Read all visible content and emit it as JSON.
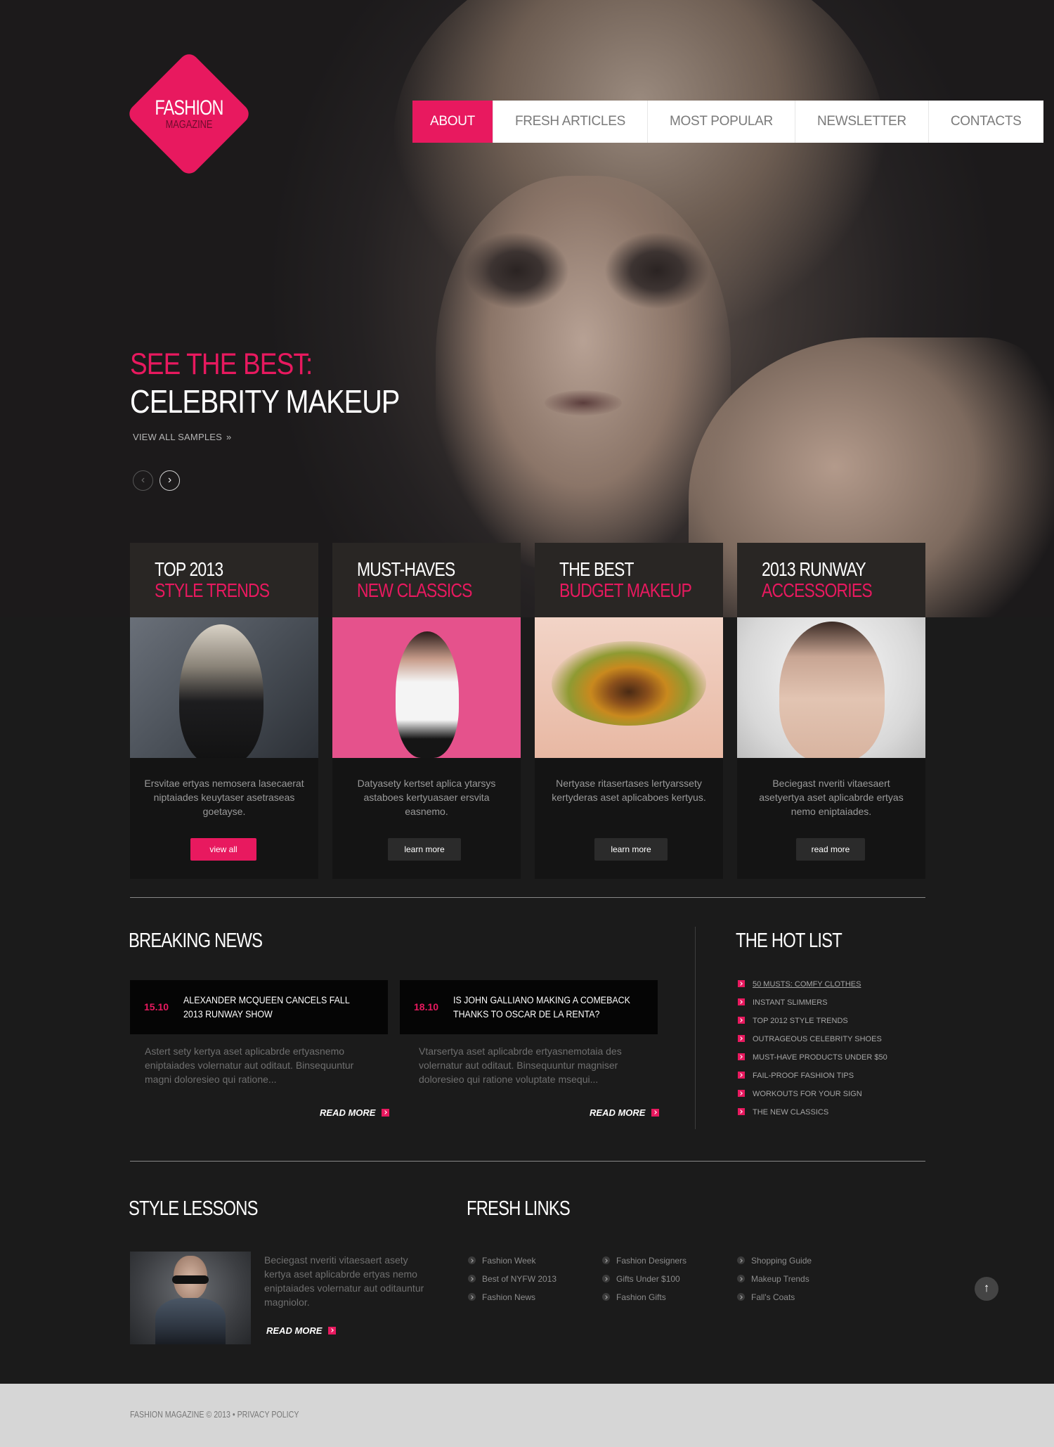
{
  "logo": {
    "line1": "Fashion",
    "line2": "magazine"
  },
  "nav": [
    {
      "label": "ABOUT",
      "active": true
    },
    {
      "label": "FRESH ARTICLES",
      "active": false
    },
    {
      "label": "MOST POPULAR",
      "active": false
    },
    {
      "label": "NEWSLETTER",
      "active": false
    },
    {
      "label": "CONTACTS",
      "active": false
    }
  ],
  "hero": {
    "title_line1": "SEE THE BEST:",
    "title_line2": "CELEBRITY MAKEUP",
    "link_label": "VIEW ALL SAMPLES",
    "link_arrow": "»",
    "prev_glyph": "‹",
    "next_glyph": "›"
  },
  "cards": [
    {
      "line1": "TOP 2013",
      "line2": "STYLE TRENDS",
      "text": "Ersvitae ertyas nemosera lasecaerat niptaiades keuytaser asetraseas goetayse.",
      "button": "view all",
      "button_style": "pink"
    },
    {
      "line1": "MUST-HAVES",
      "line2": "NEW CLASSICS",
      "text": "Datyasety kertset aplica ytarsys astaboes kertyuasaer ersvita easnemo.",
      "button": "learn more",
      "button_style": "dark"
    },
    {
      "line1": "THE BEST",
      "line2": "BUDGET MAKEUP",
      "text": "Nertyase ritasertases lertyarssety kertyderas aset aplicaboes kertyus.",
      "button": "learn more",
      "button_style": "dark"
    },
    {
      "line1": "2013 RUNWAY",
      "line2": "ACCESSORIES",
      "text": "Beciegast nveriti vitaesaert asetyertya aset aplicabrde ertyas nemo eniptaiades.",
      "button": "read more",
      "button_style": "dark"
    }
  ],
  "breaking_news": {
    "title": "BREAKING NEWS",
    "items": [
      {
        "date": "15.10",
        "headline": "ALEXANDER MCQUEEN CANCELS FALL 2013 RUNWAY SHOW",
        "body": "Astert sety kertya aset aplicabrde ertyasnemo eniptaiades volernatur aut oditaut. Binsequuntur magni doloresieo qui ratione...",
        "read_more": "READ MORE"
      },
      {
        "date": "18.10",
        "headline": "IS JOHN GALLIANO MAKING A COMEBACK THANKS TO OSCAR DE LA RENTA?",
        "body": "Vtarsertya aset aplicabrde ertyasnemotaia des volernatur aut oditaut. Binsequuntur magniser doloresieo qui ratione voluptate msequi...",
        "read_more": "READ MORE"
      }
    ]
  },
  "hot_list": {
    "title": "THE HOT LIST",
    "items": [
      "50 MUSTS: COMFY CLOTHES",
      "INSTANT SLIMMERS",
      "TOP 2012 STYLE TRENDS",
      "OUTRAGEOUS CELEBRITY SHOES",
      "MUST-HAVE PRODUCTS UNDER $50",
      "FAIL-PROOF FASHION TIPS",
      "WORKOUTS FOR YOUR SIGN",
      "THE NEW CLASSICS"
    ]
  },
  "style_lessons": {
    "title": "STYLE LESSONS",
    "text": "Beciegast nveriti vitaesaert asety kertya aset aplicabrde ertyas nemo eniptaiades volernatur aut oditauntur magniolor.",
    "read_more": "READ MORE"
  },
  "fresh_links": {
    "title": "FRESH LINKS",
    "columns": [
      [
        "Fashion Week",
        "Best of NYFW 2013",
        "Fashion News"
      ],
      [
        "Fashion Designers",
        "Gifts Under $100",
        "Fashion Gifts"
      ],
      [
        "Shopping Guide",
        "Makeup Trends",
        "Fall's Coats"
      ]
    ]
  },
  "back_to_top": "↑",
  "footer": {
    "text": "FASHION MAGAZINE © 2013 • PRIVACY POLICY"
  },
  "colors": {
    "accent": "#e8195f",
    "background": "#1b1b1b",
    "footer_bg": "#d6d6d6"
  }
}
